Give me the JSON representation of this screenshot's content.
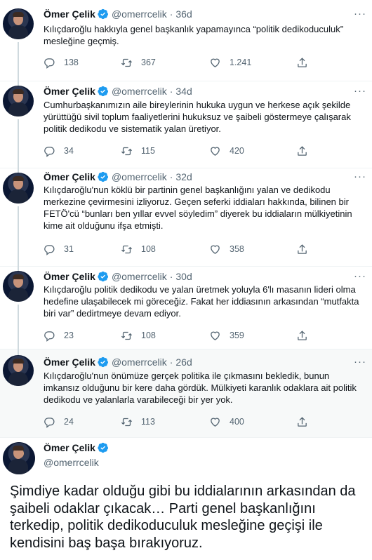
{
  "author": {
    "name": "Ömer Çelik",
    "handle": "@omerrcelik"
  },
  "separator": "·",
  "more_label": "···",
  "tweets": [
    {
      "time": "36d",
      "text": "Kılıçdaroğlu hakkıyla genel başkanlık yapamayınca “politik dedikoduculuk” mesleğine geçmiş.",
      "replies": "138",
      "retweets": "367",
      "likes": "1.241"
    },
    {
      "time": "34d",
      "text": "Cumhurbaşkanımızın aile bireylerinin hukuka uygun ve herkese açık şekilde yürüttüğü sivil toplum faaliyetlerini hukuksuz ve şaibeli göstermeye çalışarak politik dedikodu ve sistematik yalan üretiyor.",
      "replies": "34",
      "retweets": "115",
      "likes": "420"
    },
    {
      "time": "32d",
      "text": "Kılıçdaroğlu'nun köklü bir partinin genel başkanlığını  yalan ve dedikodu merkezine çevirmesini izliyoruz. Geçen seferki iddiaları hakkında, bilinen bir FETÖ'cü “bunları ben yıllar evvel söyledim” diyerek bu iddiaların mülkiyetinin kime ait olduğunu ifşa etmişti.",
      "replies": "31",
      "retweets": "108",
      "likes": "358"
    },
    {
      "time": "30d",
      "text": "Kılıçdaroğlu politik dedikodu ve yalan üretmek yoluyla 6'lı masanın lideri olma hedefine ulaşabilecek mi göreceğiz. Fakat her iddiasının arkasından “mutfakta biri var” dedirtmeye devam ediyor.",
      "replies": "23",
      "retweets": "108",
      "likes": "359"
    },
    {
      "time": "26d",
      "text": "Kılıçdaroğlu'nun önümüze gerçek politika ile çıkmasını bekledik, bunun imkansız olduğunu bir kere daha gördük. Mülkiyeti karanlık odaklara ait politik dedikodu ve yalanlarla varabileceği bir yer yok.",
      "replies": "24",
      "retweets": "113",
      "likes": "400"
    }
  ],
  "main_tweet": {
    "text": "Şimdiye kadar olduğu gibi bu iddialarının arkasından da şaibeli odaklar çıkacak… Parti genel başkanlığını terkedip, politik dedikoduculuk mesleğine geçişi ile kendisini baş başa bırakıyoruz."
  },
  "colors": {
    "verified": "#1d9bf0",
    "muted": "#536471",
    "text": "#0f1419",
    "thread_line": "#cfd9de"
  },
  "icons": [
    "reply-icon",
    "retweet-icon",
    "like-icon",
    "share-icon",
    "verified-badge-icon",
    "more-icon"
  ]
}
